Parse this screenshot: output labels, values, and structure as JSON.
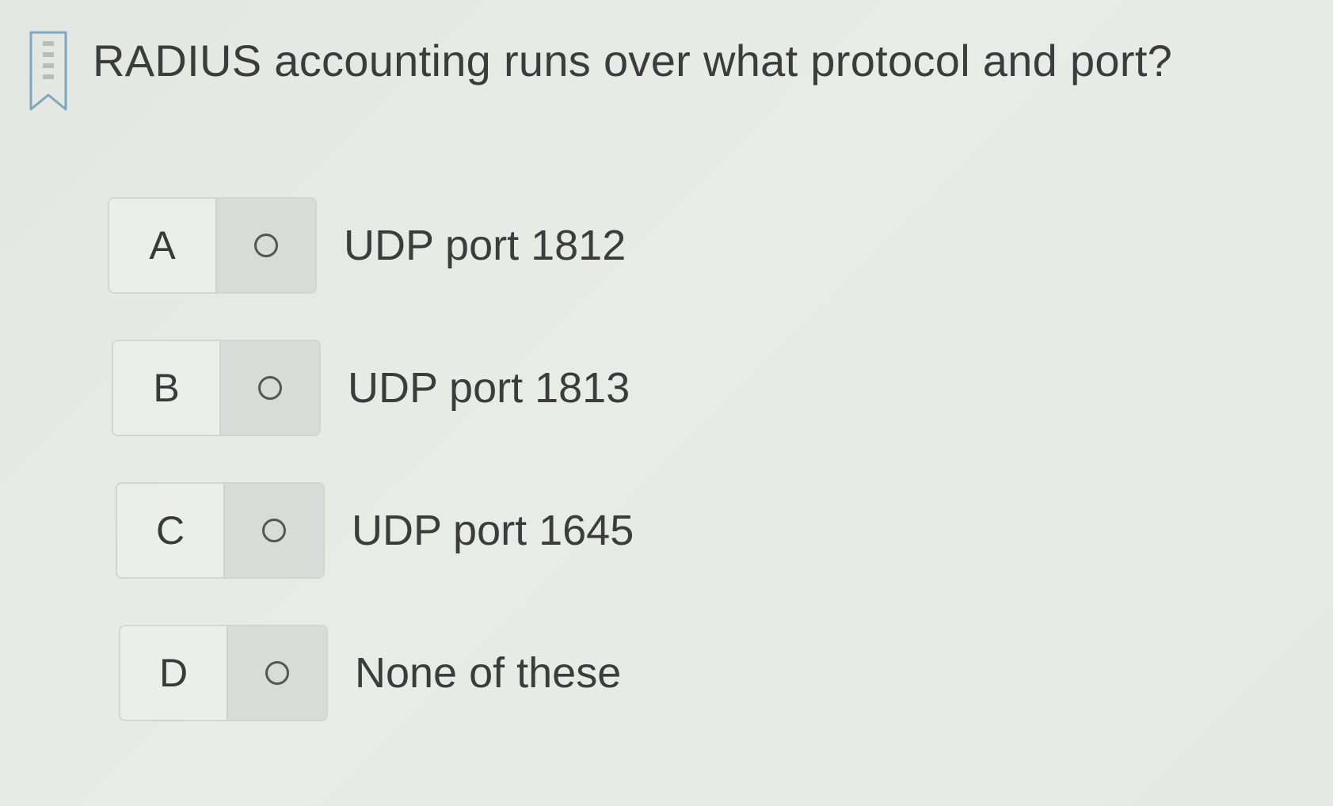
{
  "question": {
    "text": "RADIUS accounting runs over what protocol and port?",
    "bookmark_icon": "bookmark-icon"
  },
  "options": [
    {
      "letter": "A",
      "text": "UDP port 1812"
    },
    {
      "letter": "B",
      "text": "UDP port 1813"
    },
    {
      "letter": "C",
      "text": "UDP port 1645"
    },
    {
      "letter": "D",
      "text": "None of these"
    }
  ]
}
